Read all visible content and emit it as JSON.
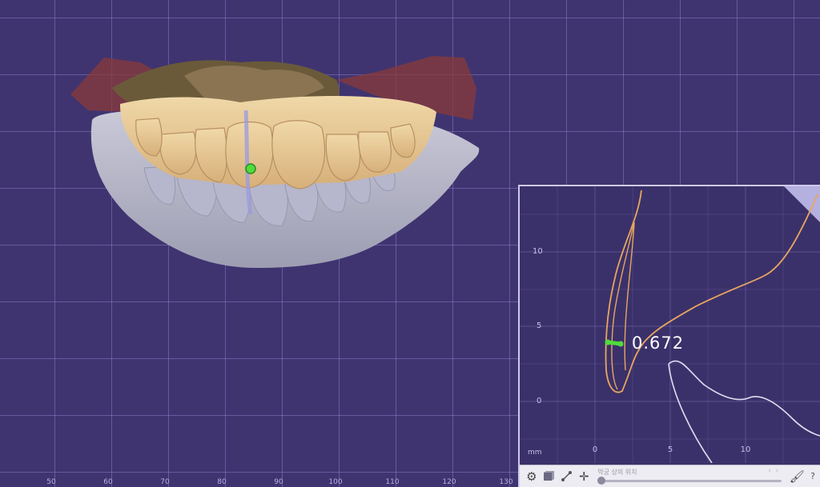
{
  "viewport": {
    "axis_ticks": [
      "50",
      "60",
      "70",
      "80",
      "90",
      "100",
      "110",
      "120",
      "130"
    ]
  },
  "section_panel": {
    "y_ticks": [
      "10",
      "5",
      "0"
    ],
    "x_ticks": [
      "0",
      "5",
      "10"
    ],
    "unit": "mm",
    "measurement": "0.672"
  },
  "toolbar": {
    "slider_label": "악궁 상의 위치",
    "slider_value": 0,
    "prev_arrow": "‹",
    "next_arrow": "›",
    "help_label": "?"
  },
  "icons": [
    "gear-icon",
    "section-view-icon",
    "measure-icon",
    "crosshair-icon",
    "brush-icon"
  ],
  "colors": {
    "background": "#3f3470",
    "grid": "#9687d7",
    "curve_orange": "#e8a660",
    "curve_white": "#e0dcf0",
    "marker_green": "#4fdc3c"
  }
}
